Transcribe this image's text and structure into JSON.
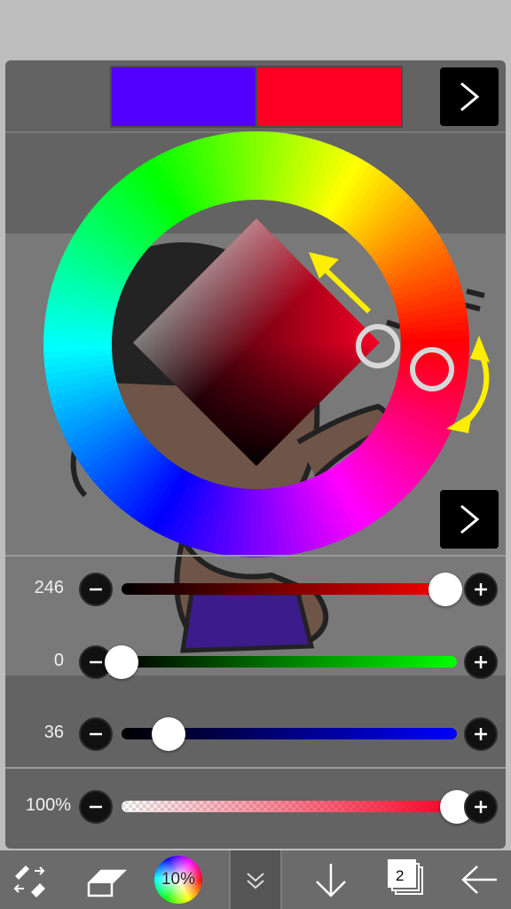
{
  "colors": {
    "primary": "#5400FF",
    "secondary": "#FF0024",
    "selected": "#F60024",
    "panel": "#636363",
    "highlight_arrow": "#FFEE00"
  },
  "swatches": {
    "primary_color": "#5400FF",
    "secondary_color": "#FF0024"
  },
  "color_wheel": {
    "hue_degrees": 354,
    "saturation_value_picker": "diamond"
  },
  "sliders": [
    {
      "name": "red",
      "value": "246",
      "level": 0.965,
      "track_color": "#FF0000"
    },
    {
      "name": "green",
      "value": "0",
      "level": 0.0,
      "track_color": "#00FF00"
    },
    {
      "name": "blue",
      "value": "36",
      "level": 0.14,
      "track_color": "#0000FF"
    },
    {
      "name": "opacity",
      "value": "100%",
      "level": 1.0,
      "track_color": "#F60024"
    }
  ],
  "toolbar": {
    "color_tool_label": "10%",
    "layer_count": "2",
    "items": [
      "tool-switch-icon",
      "eraser-icon",
      "color-wheel-icon",
      "collapse-icon",
      "download-icon",
      "layers-icon",
      "back-arrow-icon"
    ]
  }
}
